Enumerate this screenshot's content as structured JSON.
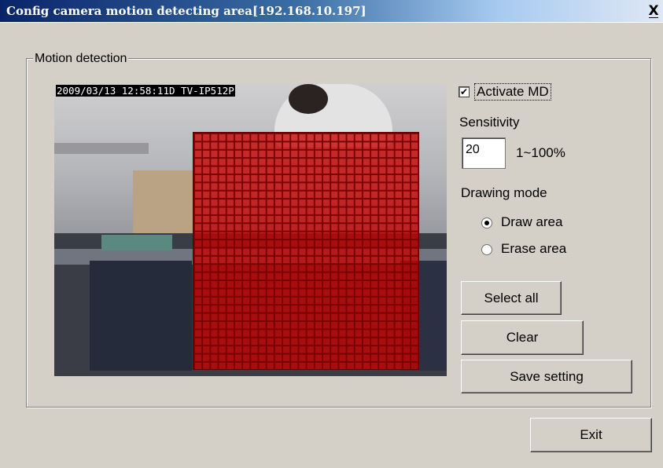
{
  "window": {
    "title": "Config camera motion detecting area[192.168.10.197]",
    "close_label": "X"
  },
  "group": {
    "label": "Motion detection"
  },
  "camera": {
    "timestamp": "2009/03/13 12:58:11D TV-IP512P",
    "overlay_color": "#c80000"
  },
  "controls": {
    "activate_md_label": "Activate MD",
    "activate_md_checked": true,
    "check_mark": "✔",
    "sensitivity_label": "Sensitivity",
    "sensitivity_value": "20",
    "sensitivity_range": "1~100%",
    "drawing_mode_label": "Drawing mode",
    "modes": [
      {
        "label": "Draw area",
        "selected": true
      },
      {
        "label": "Erase area",
        "selected": false
      }
    ],
    "select_all_label": "Select all",
    "clear_label": "Clear",
    "save_setting_label": "Save setting",
    "exit_label": "Exit"
  }
}
